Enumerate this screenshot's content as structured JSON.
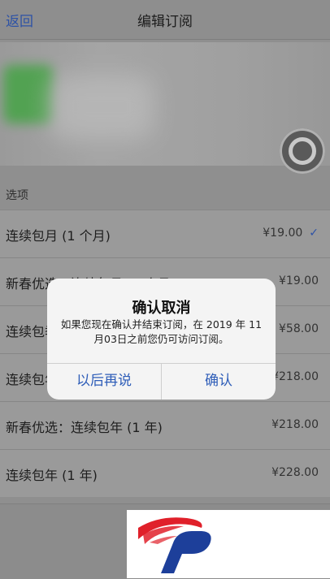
{
  "nav": {
    "back_label": "返回",
    "title": "编辑订阅"
  },
  "section": {
    "header": "选项"
  },
  "options": [
    {
      "label": "连续包月 (1 个月)",
      "price": "¥19.00",
      "selected": true
    },
    {
      "label": "新春优选：连续包月 (1 个月)",
      "price": "¥19.00"
    },
    {
      "label": "连续包季 (3 个月)",
      "price": "¥58.00"
    },
    {
      "label": "连续包年 (1 年)",
      "price": "¥218.00"
    },
    {
      "label": "新春优选：连续包年 (1 年)",
      "price": "¥218.00"
    },
    {
      "label": "连续包年 (1 年)",
      "price": "¥228.00"
    }
  ],
  "check_glyph": "✓",
  "alert": {
    "title": "确认取消",
    "message": "如果您现在确认并结束订阅，在 2019 年 11月03日之前您仍可访问订阅。",
    "cancel_label": "以后再说",
    "confirm_label": "确认"
  },
  "colors": {
    "accent": "#2d52a6",
    "logo_red": "#e0202a",
    "logo_blue": "#1d3f9a"
  },
  "icons": {
    "assistive_touch": "assistive-touch-icon",
    "checkmark": "checkmark-icon",
    "logo": "brand-logo"
  }
}
